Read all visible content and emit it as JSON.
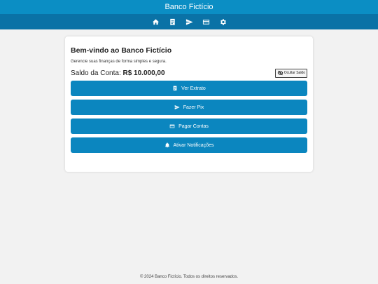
{
  "header": {
    "title": "Banco Fictício"
  },
  "nav": {
    "items": [
      {
        "name": "home",
        "icon": "home-icon"
      },
      {
        "name": "statement",
        "icon": "receipt-icon"
      },
      {
        "name": "pix",
        "icon": "send-icon"
      },
      {
        "name": "bills",
        "icon": "credit-card-icon"
      },
      {
        "name": "settings",
        "icon": "gear-icon"
      }
    ]
  },
  "main": {
    "welcome": "Bem-vindo ao Banco Fictício",
    "subtitle": "Gerencie suas finanças de forma simples e segura.",
    "balance_label": "Saldo da Conta:",
    "balance_value": "R$ 10.000,00",
    "hide_balance_label": "Ocultar Saldo",
    "actions": [
      {
        "label": "Ver Extrato",
        "icon": "receipt-icon"
      },
      {
        "label": "Fazer Pix",
        "icon": "send-icon"
      },
      {
        "label": "Pagar Contas",
        "icon": "credit-card-icon"
      },
      {
        "label": "Ativar Notificações",
        "icon": "bell-icon"
      }
    ]
  },
  "footer": {
    "text": "© 2024 Banco Fictício. Todos os direitos reservados."
  },
  "colors": {
    "header_bg": "#0b8ec4",
    "nav_bg": "#0a72a6",
    "button_bg": "#0b86bf",
    "page_bg": "#f2f2f2"
  }
}
